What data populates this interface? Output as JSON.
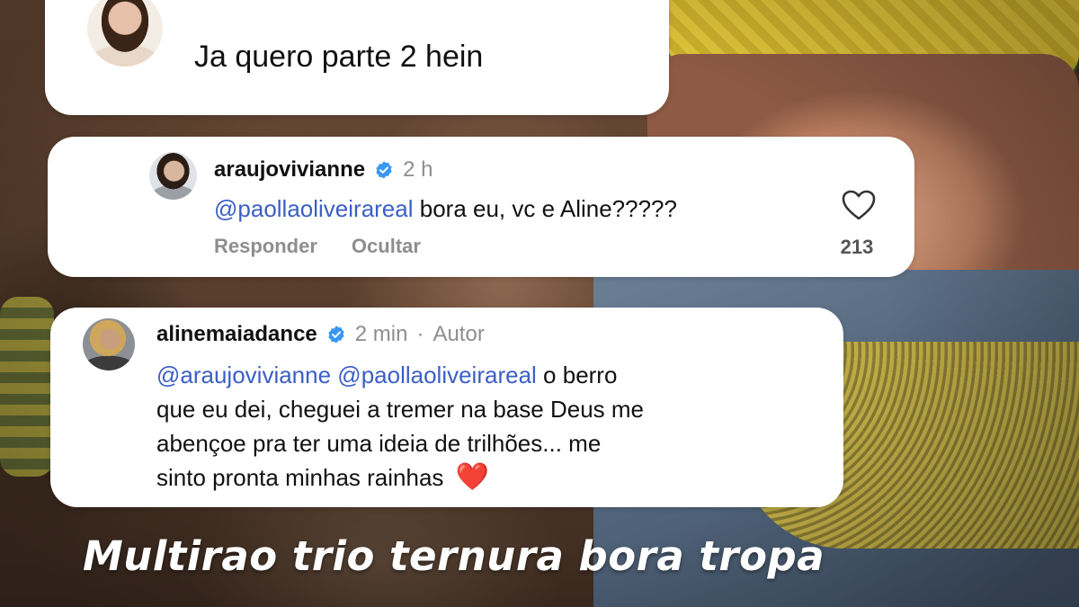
{
  "comment_1": {
    "text": "Ja quero parte 2 hein"
  },
  "comment_2": {
    "username": "araujovivianne",
    "time": "2 h",
    "mention": "@paollaoliveirareal",
    "text": "bora eu, vc e Aline?????",
    "reply_label": "Responder",
    "hide_label": "Ocultar",
    "like_count": "213",
    "icons": {
      "verified": "verified-badge-icon",
      "like": "heart-icon"
    }
  },
  "comment_3": {
    "username": "alinemaiadance",
    "time": "2 min",
    "separator": "·",
    "author_label": "Autor",
    "mention_1": "@araujovivianne",
    "mention_2": "@paollaoliveirareal",
    "line_1_tail": "o berro",
    "line_2": "que eu dei, cheguei a tremer na base Deus me",
    "line_3": "abençoe pra ter uma ideia de trilhões... me",
    "line_4": "sinto pronta minhas rainhas",
    "emoji": "❤️",
    "icons": {
      "verified": "verified-badge-icon"
    }
  },
  "caption": "Multirao trio ternura bora tropa",
  "colors": {
    "mention": "#3b5fc4",
    "verified": "#3897f0",
    "muted": "#8e8e8e",
    "heart_emoji": "#e0262f"
  }
}
